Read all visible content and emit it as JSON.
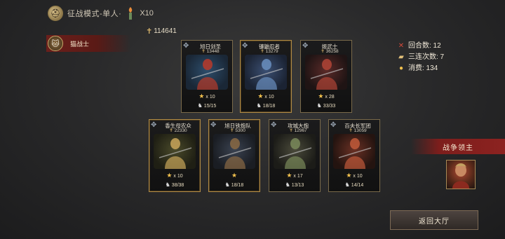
{
  "topbar": {
    "mode_title": "征战模式-单人·",
    "torch_count": "X10"
  },
  "hero_tab": {
    "label": "猫战士"
  },
  "power": "114641",
  "cards_row1": [
    {
      "name": "旭日剑圣",
      "power": "13448",
      "stars": "x 10",
      "troops": "15/15",
      "gold": false
    },
    {
      "name": "镰鼬忍者",
      "power": "13279",
      "stars": "x 10",
      "troops": "18/18",
      "gold": true
    },
    {
      "name": "姬武士",
      "power": "36258",
      "stars": "x 28",
      "troops": "33/33",
      "gold": false
    }
  ],
  "cards_row2": [
    {
      "name": "香生母农众",
      "power": "22330",
      "stars": "x 10",
      "troops": "38/38",
      "gold": true
    },
    {
      "name": "旭日铁炮队",
      "power": "5300",
      "stars": "",
      "troops": "18/18",
      "gold": true
    },
    {
      "name": "攻城大炮",
      "power": "12967",
      "stars": "x 17",
      "troops": "13/13",
      "gold": false
    },
    {
      "name": "百夫长军团",
      "power": "13059",
      "stars": "x 10",
      "troops": "14/14",
      "gold": false
    }
  ],
  "stats": {
    "rounds": "回合数: 12",
    "triple": "三连次数: 7",
    "spend": "消费: 134"
  },
  "lord": {
    "banner": "战争领主"
  },
  "back_button": "返回大厅",
  "colors": {
    "accent_red": "#8c2220",
    "gold": "#b08a45",
    "star": "#f2c14e"
  },
  "icons": [
    "helmet-icon",
    "torch-icon",
    "power-icon",
    "star-icon",
    "troops-icon",
    "crossed-swords-icon",
    "triple-icon",
    "coin-icon"
  ]
}
